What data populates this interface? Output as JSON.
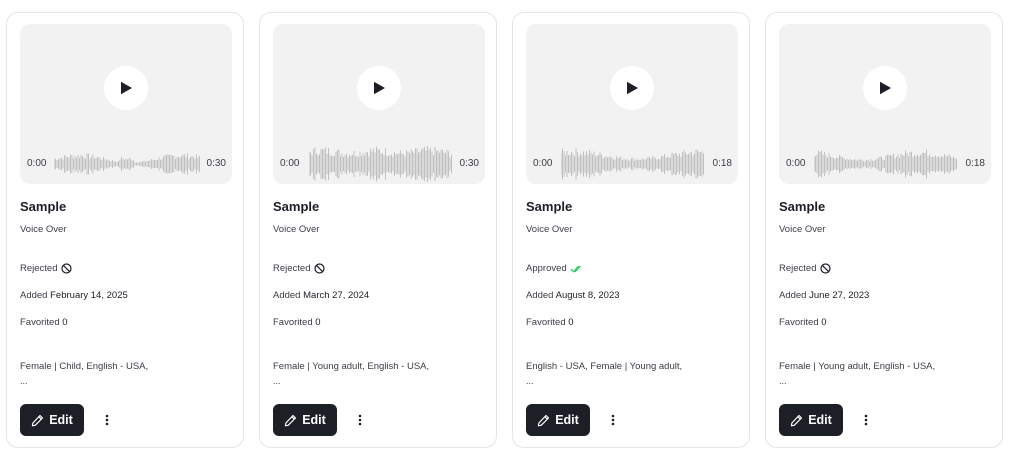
{
  "cards": [
    {
      "title": "Sample",
      "subtitle": "Voice Over",
      "time_start": "0:00",
      "time_end": "0:30",
      "status": "Rejected",
      "status_icon": "rejected-icon",
      "added_label": "Added",
      "added_date": "February 14, 2025",
      "favorited_label": "Favorited",
      "favorited_count": "0",
      "tags": "Female | Child,  English - USA,",
      "more_text": "...",
      "edit_label": "Edit"
    },
    {
      "title": "Sample",
      "subtitle": "Voice Over",
      "time_start": "0:00",
      "time_end": "0:30",
      "status": "Rejected",
      "status_icon": "rejected-icon",
      "added_label": "Added",
      "added_date": "March 27, 2024",
      "favorited_label": "Favorited",
      "favorited_count": "0",
      "tags": "Female | Young adult,  English - USA,",
      "more_text": "...",
      "edit_label": "Edit"
    },
    {
      "title": "Sample",
      "subtitle": "Voice Over",
      "time_start": "0:00",
      "time_end": "0:18",
      "status": "Approved",
      "status_icon": "approved-check-icon",
      "added_label": "Added",
      "added_date": "August 8, 2023",
      "favorited_label": "Favorited",
      "favorited_count": "0",
      "tags": "English - USA,  Female | Young adult,",
      "more_text": "...",
      "edit_label": "Edit"
    },
    {
      "title": "Sample",
      "subtitle": "Voice Over",
      "time_start": "0:00",
      "time_end": "0:18",
      "status": "Rejected",
      "status_icon": "rejected-icon",
      "added_label": "Added",
      "added_date": "June 27, 2023",
      "favorited_label": "Favorited",
      "favorited_count": "0",
      "tags": "Female | Young adult,  English - USA,",
      "more_text": "...",
      "edit_label": "Edit"
    }
  ],
  "colors": {
    "button_bg": "#1d1f27",
    "player_bg": "#f2f2f2",
    "waveform": "#b3b3b3",
    "approved": "#22c55e"
  },
  "icons": [
    "play-icon",
    "pencil-icon",
    "kebab-menu-icon",
    "rejected-icon",
    "approved-check-icon"
  ]
}
